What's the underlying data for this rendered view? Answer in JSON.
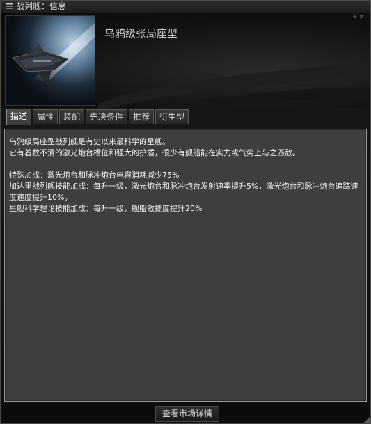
{
  "window": {
    "title": "战列舰：信息",
    "collapse_left": "«",
    "collapse_right": "»"
  },
  "header": {
    "ship_name": "乌鸦级张局座型"
  },
  "tabs": [
    {
      "label": "描述",
      "active": true
    },
    {
      "label": "属性",
      "active": false
    },
    {
      "label": "装配",
      "active": false
    },
    {
      "label": "先决条件",
      "active": false
    },
    {
      "label": "推荐",
      "active": false
    },
    {
      "label": "衍生型",
      "active": false
    }
  ],
  "description": {
    "lines": [
      "乌鸦级局座型战列舰是有史以来最科学的星舰。",
      "它有着数不清的激光炮台槽位和强大的护盾，很少有舰船能在实力或气势上与之匹敌。",
      "",
      "特殊加成：激光炮台和脉冲炮台电容消耗减少75%",
      "加达里战列舰技能加成：每升一级，激光炮台和脉冲炮台发射速率提升5%，激光炮台和脉冲炮台追踪速度速度提升10%。",
      "星舰科学理论技能加成：每升一级，舰船敏捷度提升20%"
    ]
  },
  "footer": {
    "market_button": "查看市场详情"
  },
  "icons": {
    "menu": "menu-icon",
    "resize": "resize-grip-icon"
  }
}
